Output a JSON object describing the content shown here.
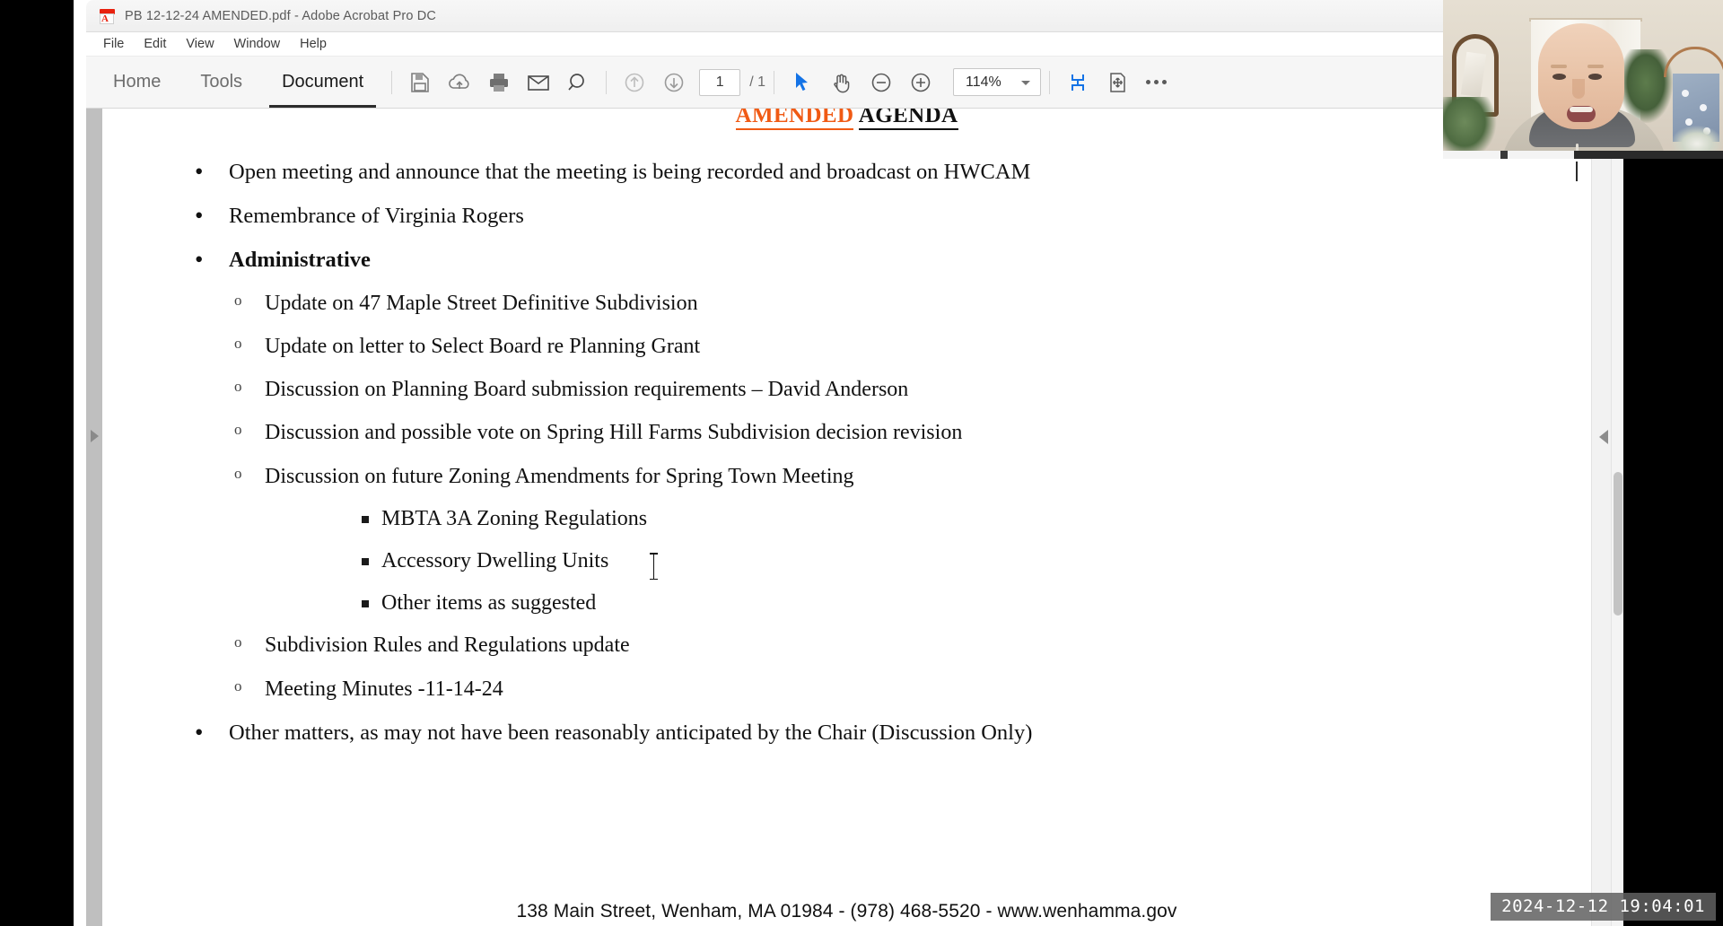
{
  "window": {
    "title": "PB  12-12-24 AMENDED.pdf - Adobe Acrobat Pro DC",
    "app_icon": "adobe-acrobat-icon"
  },
  "menubar": {
    "items": [
      {
        "label": "File"
      },
      {
        "label": "Edit"
      },
      {
        "label": "View"
      },
      {
        "label": "Window"
      },
      {
        "label": "Help"
      }
    ]
  },
  "toolbar": {
    "tabs": [
      {
        "label": "Home",
        "active": false
      },
      {
        "label": "Tools",
        "active": false
      },
      {
        "label": "Document",
        "active": true
      }
    ],
    "icons": [
      {
        "name": "save-icon",
        "title": "Save"
      },
      {
        "name": "cloud-upload-icon",
        "title": "Save to cloud"
      },
      {
        "name": "print-icon",
        "title": "Print"
      },
      {
        "name": "email-icon",
        "title": "Email"
      },
      {
        "name": "search-icon",
        "title": "Find"
      },
      {
        "name": "previous-page-icon",
        "title": "Previous page"
      },
      {
        "name": "next-page-icon",
        "title": "Next page"
      },
      {
        "name": "select-tool-icon",
        "title": "Select tool"
      },
      {
        "name": "hand-tool-icon",
        "title": "Hand tool"
      },
      {
        "name": "zoom-out-icon",
        "title": "Zoom out"
      },
      {
        "name": "zoom-in-icon",
        "title": "Zoom in"
      },
      {
        "name": "fit-width-icon",
        "title": "Fit width"
      },
      {
        "name": "fit-page-icon",
        "title": "Fit page"
      },
      {
        "name": "more-options-icon",
        "title": "More tools"
      }
    ],
    "page_current": "1",
    "page_total": "/ 1",
    "zoom_value": "114%",
    "accent_color": "#1473e6"
  },
  "document": {
    "title_amended": "AMENDED",
    "title_agenda": "AGENDA",
    "title_amended_color": "#f05a14",
    "title_agenda_color": "#111111",
    "items": [
      {
        "text": "Open meeting and announce that the meeting is being recorded and broadcast on HWCAM",
        "bold": false,
        "children": []
      },
      {
        "text": "Remembrance of Virginia Rogers",
        "bold": false,
        "children": []
      },
      {
        "text": "Administrative",
        "bold": true,
        "children": [
          {
            "text": "Update on 47 Maple Street Definitive Subdivision",
            "children": []
          },
          {
            "text": "Update on letter to Select Board re Planning Grant",
            "children": []
          },
          {
            "text": "Discussion on Planning Board submission requirements – David Anderson",
            "children": []
          },
          {
            "text": "Discussion and possible vote on Spring Hill Farms Subdivision decision revision",
            "children": []
          },
          {
            "text": "Discussion on future Zoning Amendments for Spring Town Meeting",
            "children": [
              {
                "text": "MBTA 3A Zoning Regulations"
              },
              {
                "text": "Accessory Dwelling Units"
              },
              {
                "text": "Other items as suggested"
              }
            ]
          },
          {
            "text": "Subdivision Rules and Regulations update",
            "children": []
          },
          {
            "text": "Meeting Minutes -11-14-24",
            "children": []
          }
        ]
      },
      {
        "text": "Other matters, as may not have been reasonably anticipated by the Chair (Discussion Only)",
        "bold": false,
        "children": []
      }
    ],
    "footer": "138 Main Street, Wenham, MA 01984 - (978) 468-5520 - www.wenhamma.gov"
  },
  "overlay": {
    "webcam_label": "webcam-video",
    "timestamp": "2024-12-12 19:04:01"
  },
  "navigation": {
    "left_arrow": "collapse-left-panel-icon",
    "right_arrow": "collapse-right-panel-icon"
  }
}
